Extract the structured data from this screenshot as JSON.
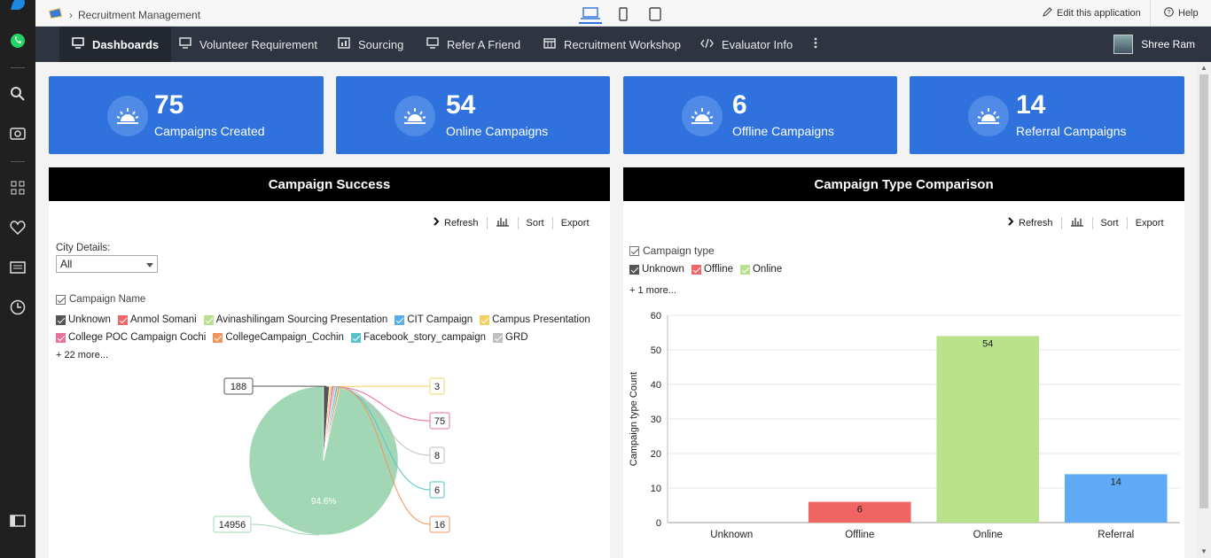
{
  "app": {
    "breadcrumb": "Recruitment Management",
    "edit_label": "Edit this application",
    "help_label": "Help"
  },
  "nav": {
    "items": [
      {
        "label": "Dashboards",
        "icon": "monitor-icon"
      },
      {
        "label": "Volunteer Requirement",
        "icon": "monitor-icon"
      },
      {
        "label": "Sourcing",
        "icon": "chart-box-icon"
      },
      {
        "label": "Refer A Friend",
        "icon": "monitor-icon"
      },
      {
        "label": "Recruitment Workshop",
        "icon": "calendar-icon"
      },
      {
        "label": "Evaluator Info",
        "icon": "code-icon"
      }
    ],
    "more_icon": "kebab-icon",
    "user_name": "Shree Ram"
  },
  "kpis": [
    {
      "value": "75",
      "label": "Campaigns Created"
    },
    {
      "value": "54",
      "label": "Online Campaigns"
    },
    {
      "value": "6",
      "label": "Offline Campaigns"
    },
    {
      "value": "14",
      "label": "Referral Campaigns"
    }
  ],
  "toolbar": {
    "refresh": "Refresh",
    "sort": "Sort",
    "export": "Export"
  },
  "panel_left": {
    "title": "Campaign Success",
    "filter_label": "City Details:",
    "filter_value": "All",
    "legend_title": "Campaign Name",
    "legend_items": [
      {
        "label": "Unknown",
        "color": "#555555"
      },
      {
        "label": "Anmol Somani",
        "color": "#ee6666"
      },
      {
        "label": "Avinashilingam Sourcing Presentation",
        "color": "#b9e08f"
      },
      {
        "label": "CIT Campaign",
        "color": "#5aaee8"
      },
      {
        "label": "Campus Presentation",
        "color": "#f6cf63"
      },
      {
        "label": "College POC Campaign Cochi",
        "color": "#ec6f9c"
      },
      {
        "label": "CollegeCampaign_Cochin",
        "color": "#f0955c"
      },
      {
        "label": "Facebook_story_campaign",
        "color": "#56c3cc"
      },
      {
        "label": "GRD",
        "color": "#bfbfbf"
      }
    ],
    "more_label": "+ 22 more..."
  },
  "panel_right": {
    "title": "Campaign Type Comparison",
    "legend_title": "Campaign type",
    "legend_items": [
      {
        "label": "Unknown",
        "color": "#555555"
      },
      {
        "label": "Offline",
        "color": "#ee6666"
      },
      {
        "label": "Online",
        "color": "#b9e08f"
      }
    ],
    "more_label": "+ 1 more..."
  },
  "chart_data": [
    {
      "type": "pie",
      "title": "Campaign Success",
      "slices": [
        {
          "value": 14956,
          "color": "#a2d7b5"
        },
        {
          "value": 188,
          "color": "#555555"
        },
        {
          "value": 3,
          "color": "#f6cf63"
        },
        {
          "value": 75,
          "color": "#ec6f9c"
        },
        {
          "value": 8,
          "color": "#bfbfbf"
        },
        {
          "value": 6,
          "color": "#56c3cc"
        },
        {
          "value": 16,
          "color": "#f0955c"
        }
      ],
      "labels": [
        "188",
        "3",
        "75",
        "8",
        "6",
        "16",
        "14956"
      ],
      "percent_label": "94.6%"
    },
    {
      "type": "bar",
      "title": "Campaign Type Comparison",
      "categories": [
        "Unknown",
        "Offline",
        "Online",
        "Referral"
      ],
      "values": [
        0,
        6,
        54,
        14
      ],
      "colors": [
        "#555555",
        "#f06463",
        "#b9e38a",
        "#5eaaf5"
      ],
      "ylabel": "Campaign type Count",
      "xlabel": "",
      "ylim": [
        0,
        60
      ],
      "yticks": [
        0,
        10,
        20,
        30,
        40,
        50,
        60
      ],
      "grid": true
    }
  ]
}
